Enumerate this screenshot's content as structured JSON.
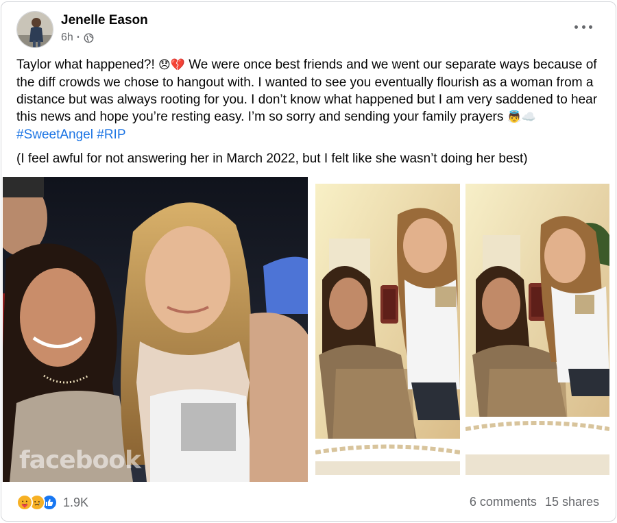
{
  "post": {
    "author": "Jenelle Eason",
    "time": "6h",
    "separator": "·",
    "privacy_icon": "globe-icon",
    "menu_icon": "more-options-icon",
    "text_part1": "Taylor what happened?! ",
    "emoji1": "😞💔",
    "text_part2": " We were once best friends and we went our separate ways because of the diff crowds we chose to hangout with. I wanted to see you eventually flourish as a woman from a distance but was always rooting for you. I don’t know what happened but I am very saddened to hear this news and hope you’re resting easy. I’m so sorry and sending your family prayers ",
    "emoji2": "👼☁️",
    "hashtag1": "#SweetAngel",
    "hashtag2": "#RIP",
    "note": "(I feel awful for not answering her in March 2022, but I felt like she wasn’t doing her best)"
  },
  "photos": {
    "watermark": "facebook"
  },
  "footer": {
    "reaction_icons": [
      "care-icon",
      "sad-icon",
      "like-icon"
    ],
    "reaction_count": "1.9K",
    "comments": "6 comments",
    "shares": "15 shares"
  },
  "colors": {
    "link": "#1b74e4",
    "secondary_text": "#65676b",
    "like_blue": "#1877f2"
  }
}
